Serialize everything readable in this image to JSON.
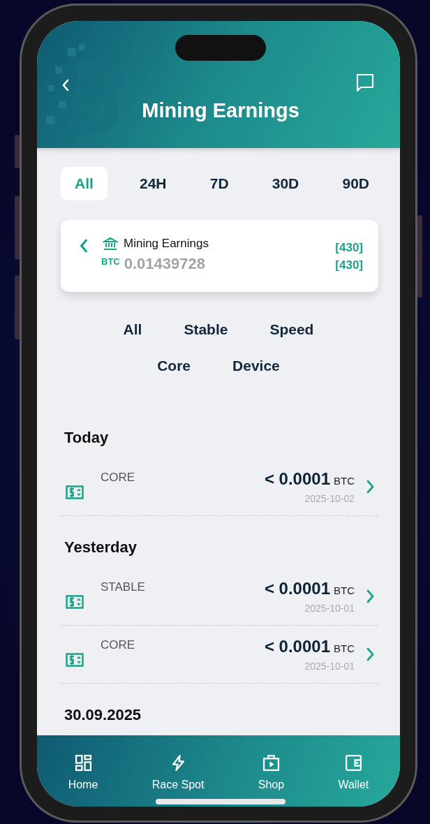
{
  "header": {
    "title": "Mining Earnings"
  },
  "periods": [
    {
      "label": "All",
      "selected": true
    },
    {
      "label": "24H",
      "selected": false
    },
    {
      "label": "7D",
      "selected": false
    },
    {
      "label": "30D",
      "selected": false
    },
    {
      "label": "90D",
      "selected": false
    }
  ],
  "summary": {
    "title": "Mining Earnings",
    "currency": "BTC",
    "amount": "0.01439728",
    "count_1": "[430]",
    "count_2": "[430]"
  },
  "filters": [
    "All",
    "Stable",
    "Speed",
    "Core",
    "Device"
  ],
  "groups": [
    {
      "title": "Today",
      "items": [
        {
          "category": "CORE",
          "amount": "< 0.0001",
          "unit": "BTC",
          "date": "2025-10-02"
        }
      ]
    },
    {
      "title": "Yesterday",
      "items": [
        {
          "category": "STABLE",
          "amount": "< 0.0001",
          "unit": "BTC",
          "date": "2025-10-01"
        },
        {
          "category": "CORE",
          "amount": "< 0.0001",
          "unit": "BTC",
          "date": "2025-10-01"
        }
      ]
    },
    {
      "title": "30.09.2025"
    }
  ],
  "nav": [
    {
      "kind": "home",
      "label": "Home"
    },
    {
      "kind": "bolt",
      "label": "Race Spot"
    },
    {
      "kind": "shop",
      "label": "Shop"
    },
    {
      "kind": "wallet",
      "label": "Wallet"
    }
  ]
}
